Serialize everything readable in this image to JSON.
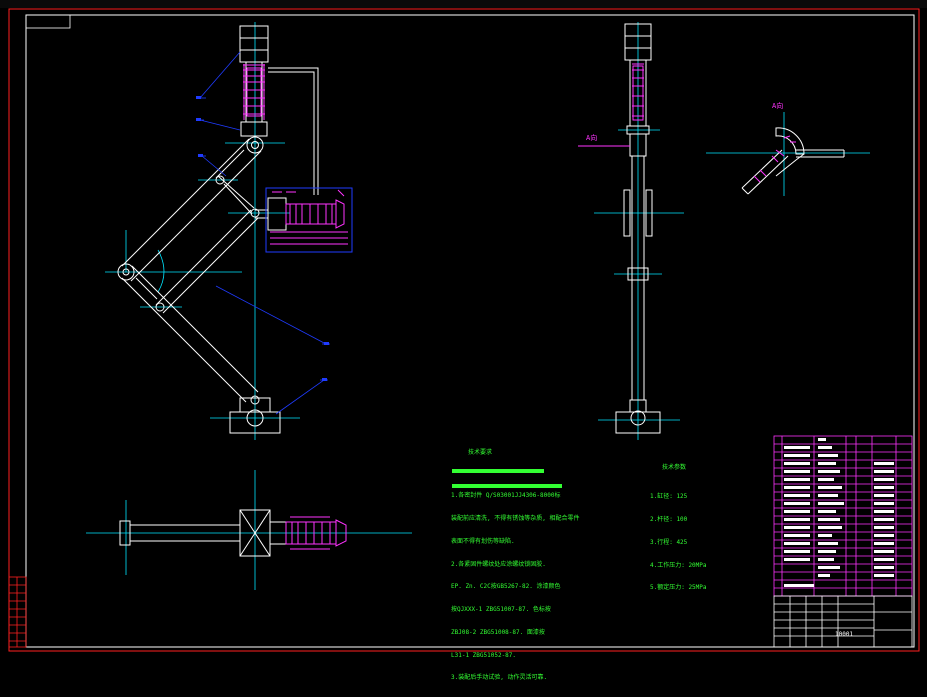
{
  "view_labels": {
    "side_view_arrow": "A向",
    "section_view_title": "A向"
  },
  "tech_notes_1": {
    "heading": "技术要求",
    "lines": [
      "1.各密封件 Q/S03001JJ4306-8000标",
      "装配前应清洗, 不得有锈蚀等杂质, 相配合零件",
      "表面不得有划伤等缺陷.",
      "2.各紧固件螺纹处应涂螺纹锁固胶.",
      "EP. Zn. C2C按GB5267-82. 涂漆颜色",
      "按QJXXX-1 ZBG51007-87. 色标按",
      "ZBJ08-2 ZBG51008-87. 面漆按",
      "L31-1 ZBG51052-87.",
      "3.装配后手动试验, 动作灵活可靠."
    ]
  },
  "tech_notes_2": {
    "heading": "技术参数",
    "lines": [
      "1.缸径: 125",
      "2.杆径: 100",
      "3.行程: 425",
      "4.工作压力: 20MPa",
      "5.额定压力: 25MPa"
    ]
  },
  "title_block": {
    "sheet_mark": "10001"
  },
  "colors": {
    "frame": "#ff2020",
    "outline": "#ffffff",
    "center": "#00e5ff",
    "detail": "#ff33ff",
    "leader": "#1f3bff",
    "text": "#33ff33"
  }
}
